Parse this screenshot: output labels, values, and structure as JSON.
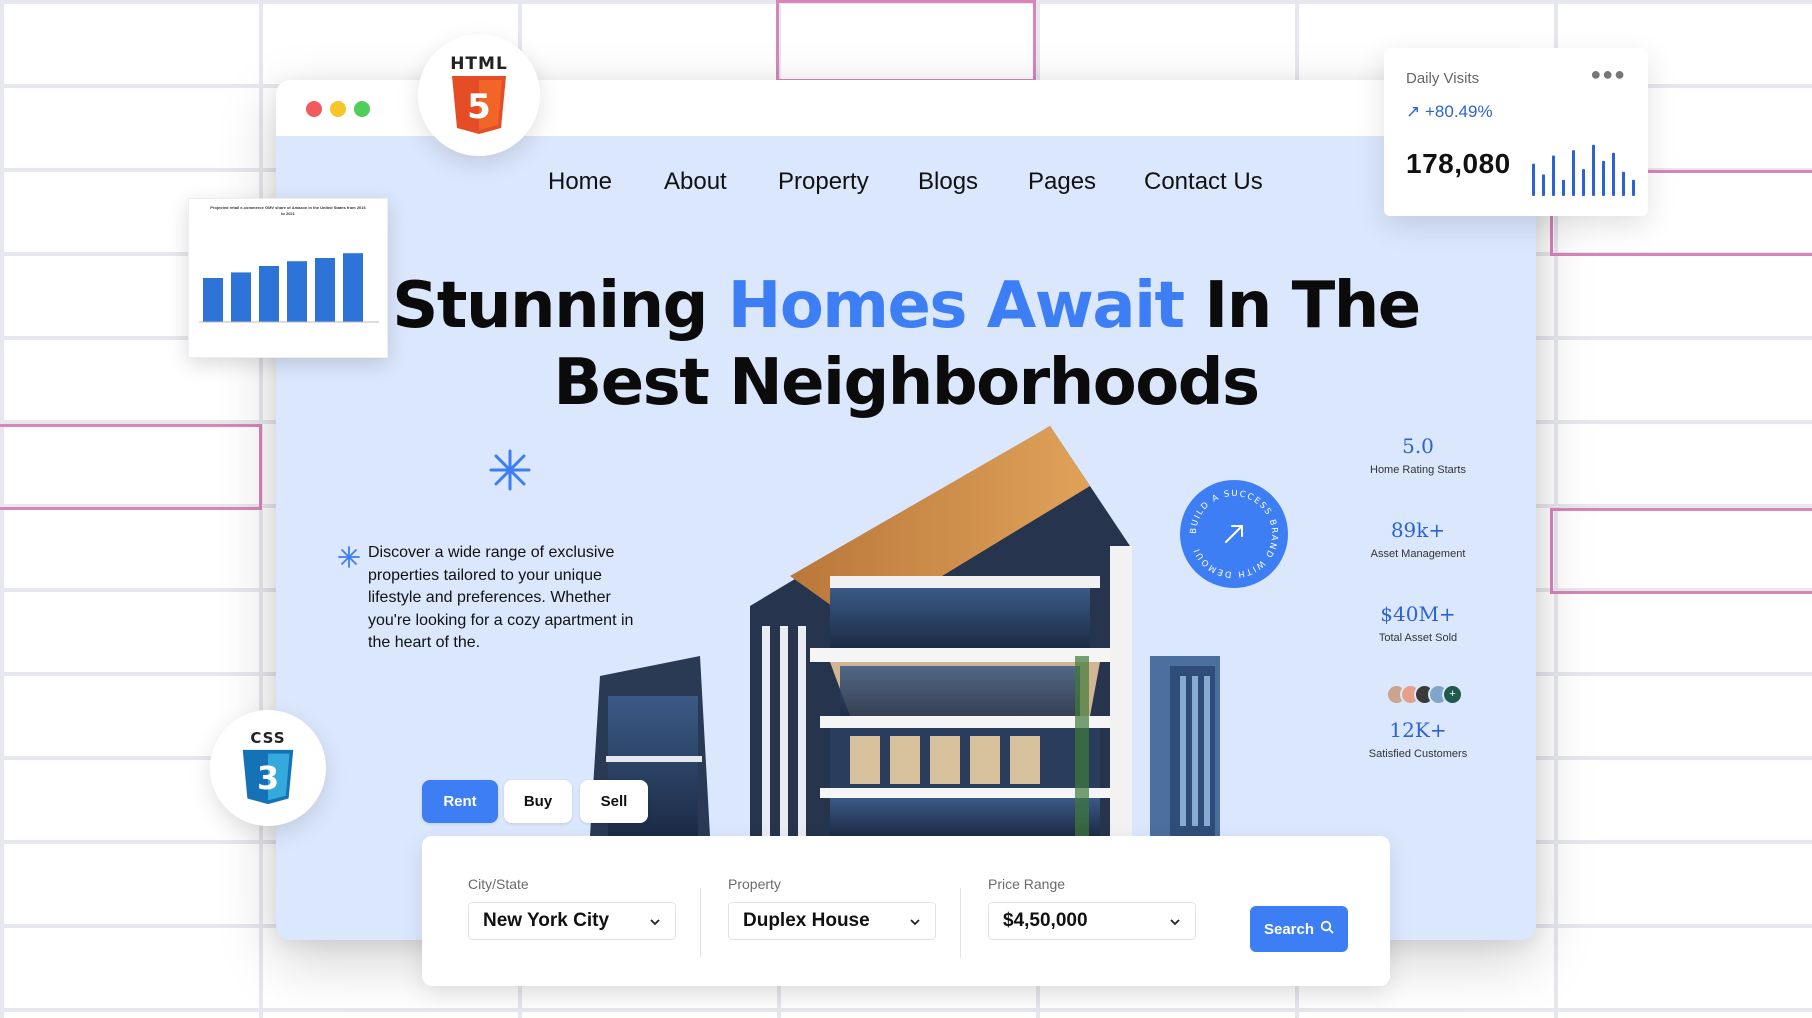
{
  "nav": {
    "items": [
      "Home",
      "About",
      "Property",
      "Blogs",
      "Pages",
      "Contact Us"
    ]
  },
  "hero": {
    "headline_part1": "Stunning ",
    "headline_highlight": "Homes Await",
    "headline_part2": " In The",
    "headline_line2": "Best Neighborhoods",
    "description": "Discover a wide range of exclusive properties tailored to your unique lifestyle and preferences. Whether you're looking for a cozy apartment in the heart of the.",
    "badge_text": "BUILD A SUCCESS BRAND WITH DEMOUI"
  },
  "stats": [
    {
      "value": "5.0",
      "label": "Home Rating Starts"
    },
    {
      "value": "89k+",
      "label": "Asset Management"
    },
    {
      "value": "$40M+",
      "label": "Total Asset Sold"
    },
    {
      "value": "12K+",
      "label": "Satisfied Customers"
    }
  ],
  "tabs": {
    "rent": "Rent",
    "buy": "Buy",
    "sell": "Sell",
    "active": "Rent"
  },
  "search": {
    "city_label": "City/State",
    "city_value": "New York City",
    "property_label": "Property",
    "property_value": "Duplex House",
    "price_label": "Price Range",
    "price_value": "$4,50,000",
    "button_label": "Search"
  },
  "badges": {
    "html": "HTML",
    "html_number": "5",
    "css": "CSS",
    "css_number": "3"
  },
  "chart_card": {
    "title": "Projected retail e-commerce GMV share of Amazon in the United States from 2016 to 2021"
  },
  "daily_visits": {
    "title": "Daily Visits",
    "change": "+80.49%",
    "value": "178,080"
  },
  "colors": {
    "accent": "#3d7ef5",
    "hero_bg": "#dbe7fd",
    "stat_text": "#2b63d6"
  },
  "chart_data": [
    {
      "type": "bar",
      "title": "Projected retail e-commerce GMV share of Amazon in the United States from 2016 to 2021",
      "values": [
        55,
        62,
        70,
        76,
        80,
        86
      ]
    },
    {
      "type": "bar",
      "values": [
        60,
        40,
        75,
        30,
        85,
        50,
        95,
        65,
        80,
        45,
        30
      ]
    }
  ]
}
